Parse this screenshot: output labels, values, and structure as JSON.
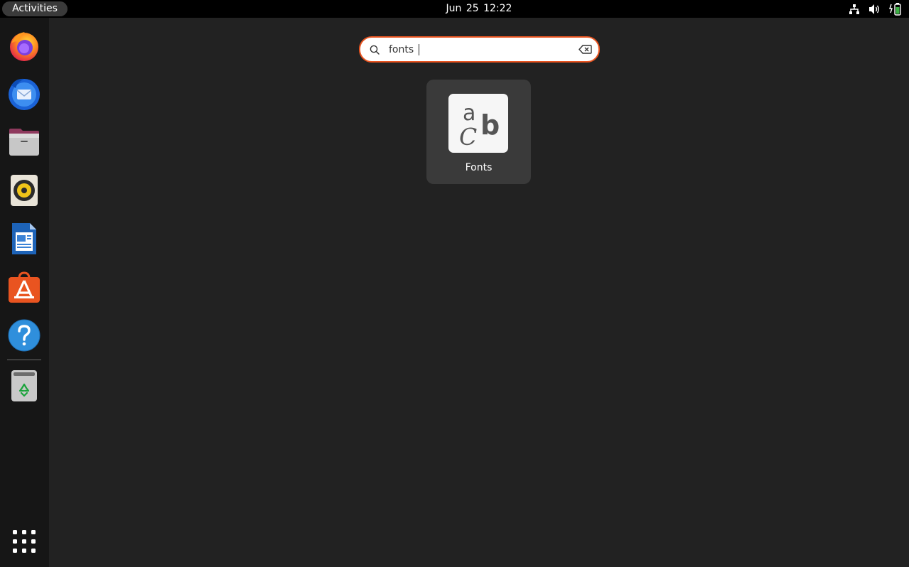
{
  "topbar": {
    "activities_label": "Activities",
    "clock": "Jun 25  12:22",
    "tray": [
      "network-icon",
      "volume-icon",
      "battery-icon"
    ]
  },
  "dock": {
    "apps": [
      "Firefox",
      "Thunderbird",
      "Files",
      "Rhythmbox",
      "LibreOffice Writer",
      "Ubuntu Software",
      "Help"
    ],
    "trash": "Trash",
    "show_apps": "Show Applications"
  },
  "search": {
    "value": "fonts",
    "accent": "#e95420"
  },
  "results": [
    {
      "label": "Fonts",
      "icon": "fonts-icon",
      "glyphs": {
        "a": "a",
        "b": "b",
        "c": "C"
      }
    }
  ]
}
